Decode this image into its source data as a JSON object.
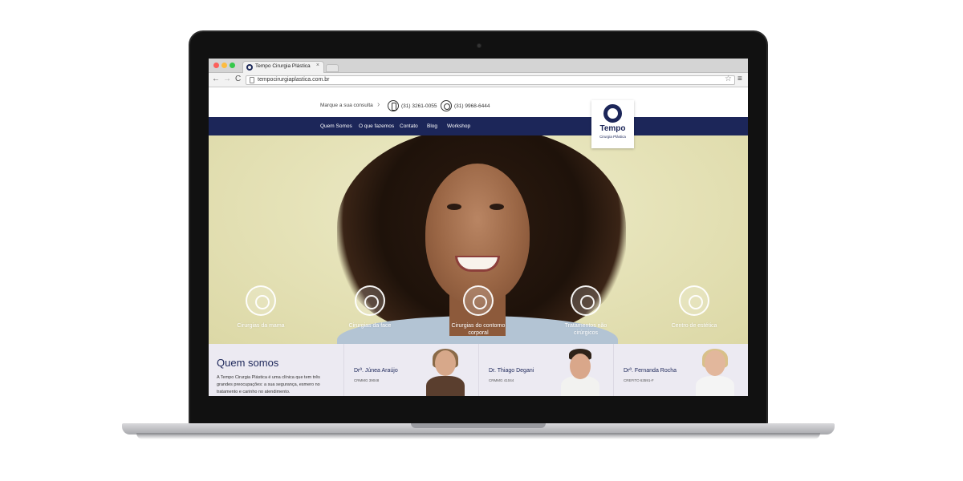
{
  "browser": {
    "tab_title": "Tempo Cirurgia Plástica",
    "tab_close": "×",
    "url": "tempocirurgiaplastica.com.br",
    "back": "←",
    "forward": "→",
    "reload": "C",
    "star": "☆",
    "menu": "≡"
  },
  "site": {
    "cta": "Marque a sua consulta",
    "cta_arrow": "›",
    "phone": "(31) 3261-0055",
    "whatsapp": "(31) 9968-6444",
    "nav": [
      "Quem Somos",
      "O que fazemos",
      "Contato",
      "Blog",
      "Workshop"
    ],
    "logo": {
      "name": "Tempo",
      "sub": "Cirurgia Plástica"
    },
    "services": [
      {
        "label": "Cirurgias da mama",
        "icon": "breast-icon"
      },
      {
        "label": "Cirurgias da face",
        "icon": "face-icon"
      },
      {
        "label": "Cirurgias do contorno corporal",
        "icon": "body-contour-icon"
      },
      {
        "label": "Tratamentos não cirúrgicos",
        "icon": "syringe-icon"
      },
      {
        "label": "Centro de estética",
        "icon": "spa-icon"
      }
    ],
    "about": {
      "title": "Quem somos",
      "text": "A Tempo Cirurgia Plástica é uma clínica que tem três grandes preocupações: a sua segurança, esmero no tratamento e carinho no atendimento."
    },
    "doctors": [
      {
        "name": "Drª. Júnea Araújo",
        "reg": "CRMMG 39048"
      },
      {
        "name": "Dr. Thiago Degani",
        "reg": "CRMMG 41044"
      },
      {
        "name": "Drª. Fernanda Rocha",
        "reg": "CREFITO 63591-F"
      }
    ],
    "colors": {
      "navy": "#1c2659",
      "hero_bg": "#e6e3b9"
    }
  }
}
